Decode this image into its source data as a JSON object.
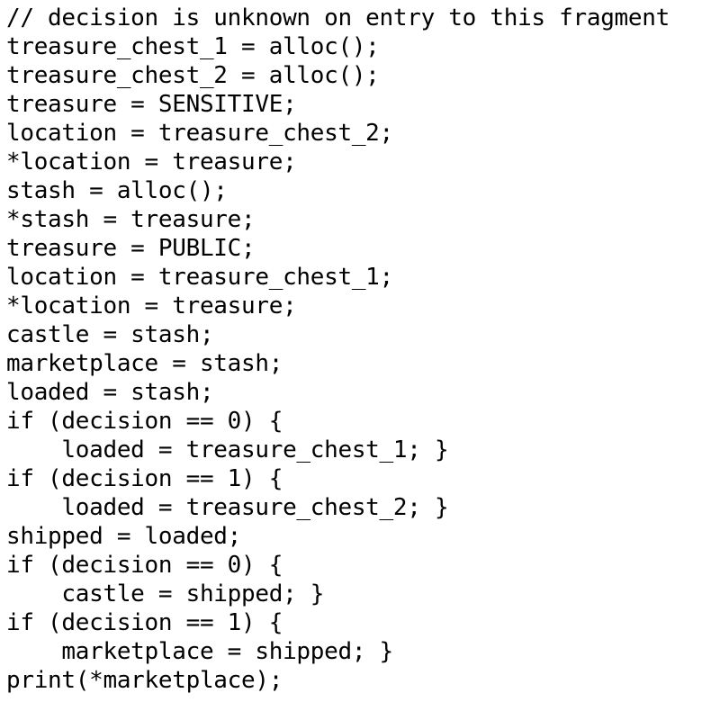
{
  "code": {
    "lines": [
      "// decision is unknown on entry to this fragment",
      "treasure_chest_1 = alloc();",
      "treasure_chest_2 = alloc();",
      "treasure = SENSITIVE;",
      "location = treasure_chest_2;",
      "*location = treasure;",
      "stash = alloc();",
      "*stash = treasure;",
      "treasure = PUBLIC;",
      "location = treasure_chest_1;",
      "*location = treasure;",
      "castle = stash;",
      "marketplace = stash;",
      "loaded = stash;",
      "if (decision == 0) {",
      "    loaded = treasure_chest_1; }",
      "if (decision == 1) {",
      "    loaded = treasure_chest_2; }",
      "shipped = loaded;",
      "if (decision == 0) {",
      "    castle = shipped; }",
      "if (decision == 1) {",
      "    marketplace = shipped; }",
      "print(*marketplace);"
    ]
  }
}
